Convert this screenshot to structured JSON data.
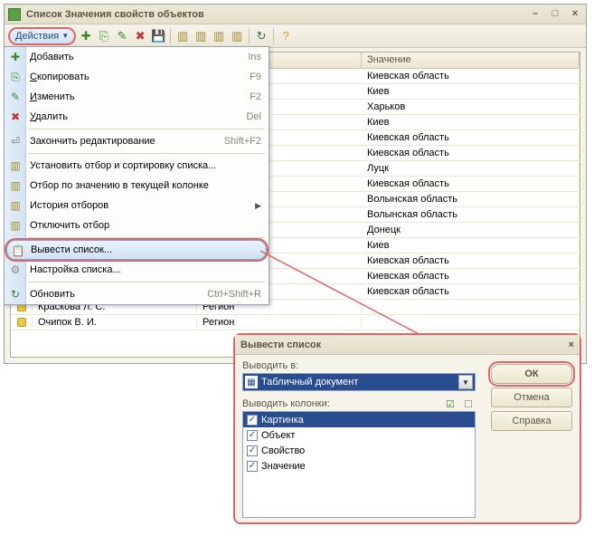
{
  "window": {
    "title": "Список Значения свойств объектов"
  },
  "toolbar": {
    "actions_label": "Действия"
  },
  "grid": {
    "headers": {
      "col_value": "Значение"
    },
    "rows": [
      {
        "value": "Киевская область"
      },
      {
        "value": "Киев"
      },
      {
        "value": "Харьков"
      },
      {
        "value": "Киев"
      },
      {
        "value": "Киевская область"
      },
      {
        "value": "Киевская область"
      },
      {
        "value": "Луцк"
      },
      {
        "value": "Киевская область"
      },
      {
        "value": "Волынская область"
      },
      {
        "value": "Волынская область"
      },
      {
        "value": "Донецк"
      },
      {
        "value": "Киев"
      },
      {
        "value": "Киевская область"
      },
      {
        "value": "Киевская область"
      },
      {
        "value": "Киевская область"
      }
    ],
    "tail": [
      {
        "obj": "Краскова Л. С.",
        "prop": "Регион"
      },
      {
        "obj": "Очипок В. И.",
        "prop": "Регион"
      }
    ]
  },
  "menu": {
    "add": {
      "pre": "",
      "key": "Д",
      "post": "обавить",
      "sc": "Ins"
    },
    "copy": {
      "pre": "",
      "key": "С",
      "post": "копировать",
      "sc": "F9"
    },
    "edit": {
      "pre": "",
      "key": "И",
      "post": "зменить",
      "sc": "F2"
    },
    "delete": {
      "pre": "",
      "key": "У",
      "post": "далить",
      "sc": "Del"
    },
    "endedit": {
      "label": "Закончить редактирование",
      "sc": "Shift+F2"
    },
    "filter": {
      "label": "Установить отбор и сортировку списка..."
    },
    "filtercol": {
      "label": "Отбор по значению в текущей колонке"
    },
    "history": {
      "label": "История отборов"
    },
    "off": {
      "label": "Отключить отбор"
    },
    "export": {
      "label": "Вывести список..."
    },
    "settings": {
      "label": "Настройка списка..."
    },
    "refresh": {
      "label": "Обновить",
      "sc": "Ctrl+Shift+R"
    }
  },
  "dialog": {
    "title": "Вывести список",
    "output_to": "Выводить в:",
    "combo_value": "Табличный документ",
    "cols_label": "Выводить колонки:",
    "cols": [
      {
        "name": "Картинка",
        "checked": true,
        "sel": true
      },
      {
        "name": "Объект",
        "checked": true,
        "sel": false
      },
      {
        "name": "Свойство",
        "checked": true,
        "sel": false
      },
      {
        "name": "Значение",
        "checked": true,
        "sel": false
      }
    ],
    "buttons": {
      "ok": "ОК",
      "cancel": "Отмена",
      "help": "Справка"
    }
  },
  "colors": {
    "highlight": "#d66",
    "accent": "#2a4d8f"
  }
}
